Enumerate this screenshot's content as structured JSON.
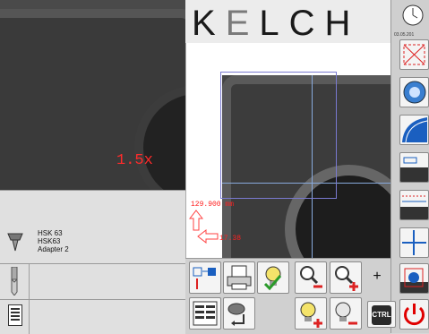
{
  "camera_left": {
    "zoom_label": "1.5x"
  },
  "tool": {
    "holder_line1": "HSK 63",
    "holder_line2": "HSK63",
    "holder_line3": "Adapter 2"
  },
  "logo": {
    "text_k": "K",
    "text_e": "E",
    "text_rest": "LCH"
  },
  "measurement": {
    "x_value": "129.900 mm",
    "z_value": "17.38"
  },
  "clock": {
    "date": "03.05.201"
  },
  "bottom": {
    "plus_label": "+",
    "ctrl_label": "CTRL"
  },
  "colors": {
    "measurement": "#ff2020",
    "power": "#e00000",
    "accent": "#1a5fc0"
  },
  "icons": [
    "tool-holder-icon",
    "drill-icon",
    "list-icon",
    "save-icon",
    "printer-icon",
    "bulb-check-icon",
    "zoom-out-icon",
    "zoom-in-icon",
    "table-icon",
    "holder-arrow-icon",
    "bulb-plus-icon",
    "bulb-minus-icon",
    "power-icon",
    "clock-icon",
    "crosshair-icon",
    "lens-icon",
    "contour-icon",
    "measure-icon",
    "grid-icon",
    "axis-icon",
    "target-icon"
  ]
}
